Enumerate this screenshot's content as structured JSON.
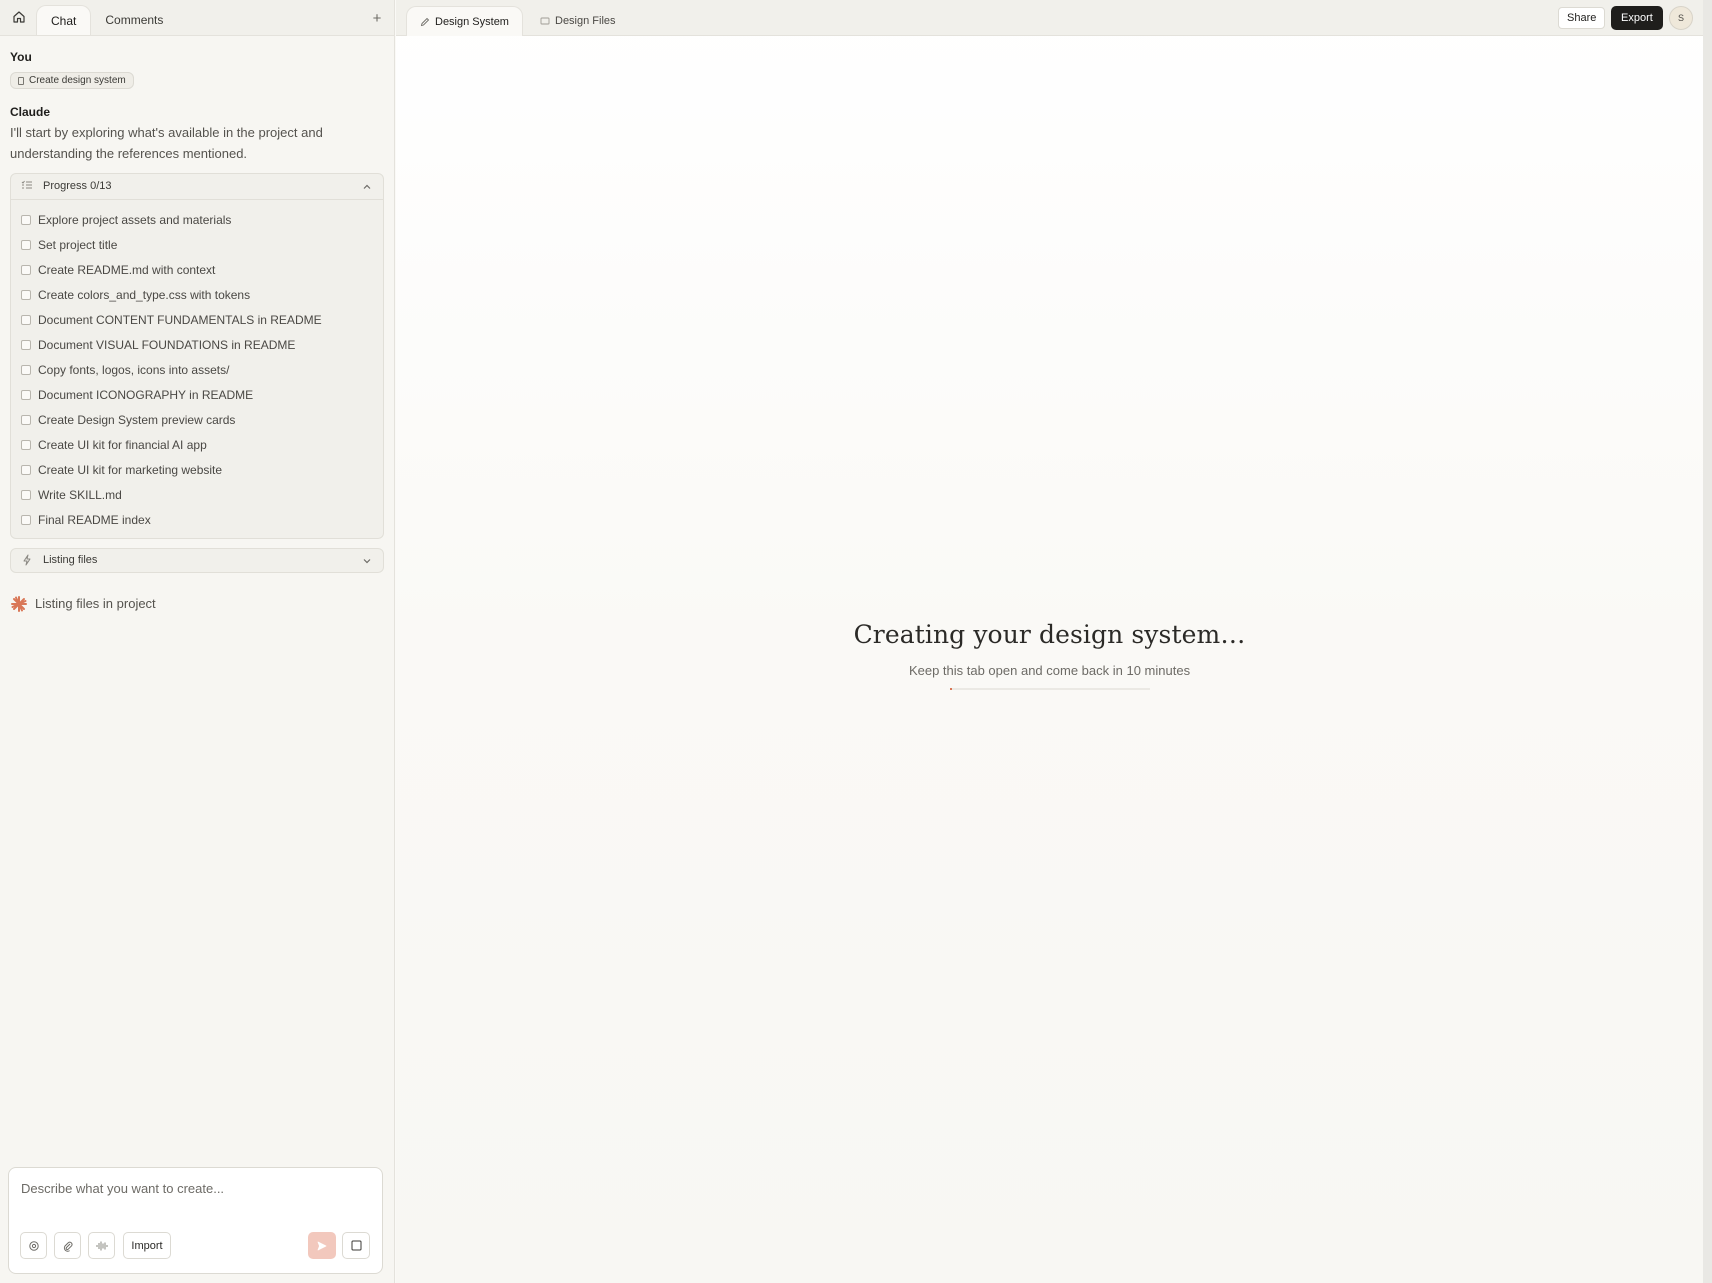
{
  "left_panel": {
    "tabs": [
      {
        "label": "Chat",
        "active": true
      },
      {
        "label": "Comments",
        "active": false
      }
    ],
    "chat": {
      "user_name": "You",
      "user_chip": "Create design system",
      "assistant_name": "Claude",
      "assistant_message": "I'll start by exploring what's available in the project and understanding the references mentioned."
    },
    "progress": {
      "label": "Progress 0/13",
      "tasks": [
        "Explore project assets and materials",
        "Set project title",
        "Create README.md with context",
        "Create colors_and_type.css with tokens",
        "Document CONTENT FUNDAMENTALS in README",
        "Document VISUAL FOUNDATIONS in README",
        "Copy fonts, logos, icons into assets/",
        "Document ICONOGRAPHY in README",
        "Create Design System preview cards",
        "Create UI kit for financial AI app",
        "Create UI kit for marketing website",
        "Write SKILL.md",
        "Final README index"
      ]
    },
    "tool_call": {
      "label": "Listing files"
    },
    "status": {
      "text": "Listing files in project"
    },
    "composer": {
      "placeholder": "Describe what you want to create...",
      "import_label": "Import"
    }
  },
  "right_panel": {
    "tabs": [
      {
        "label": "Design System",
        "active": true
      },
      {
        "label": "Design Files",
        "active": false
      }
    ],
    "share_label": "Share",
    "export_label": "Export",
    "avatar_initial": "S",
    "loading": {
      "headline": "Creating your design system…",
      "subline": "Keep this tab open and come back in 10 minutes",
      "progress_fraction": 0.01
    }
  },
  "colors": {
    "accent": "#d97757",
    "dark_button": "#1f1e1c",
    "send_disabled": "#f2c8bd"
  }
}
